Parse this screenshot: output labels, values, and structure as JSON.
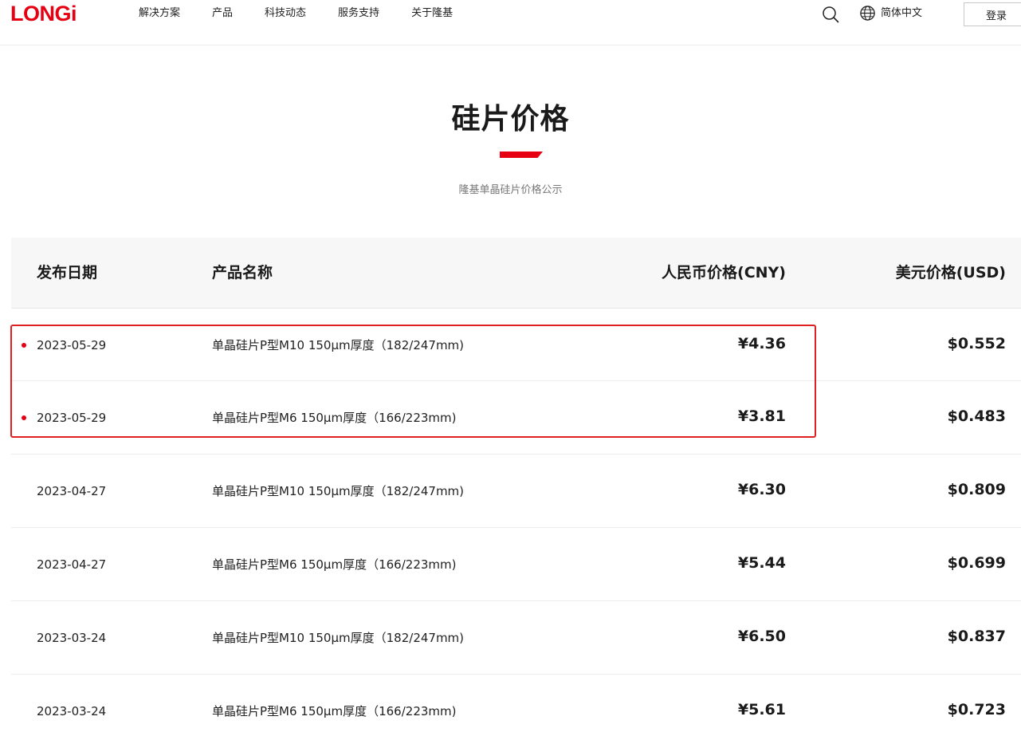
{
  "header": {
    "logo": "LONGi",
    "nav": [
      "解决方案",
      "产品",
      "科技动态",
      "服务支持",
      "关于隆基"
    ],
    "language": "简体中文",
    "login": "登录",
    "icons": {
      "search": "search-icon",
      "language": "globe-icon"
    }
  },
  "page": {
    "title": "硅片价格",
    "subtitle": "隆基单晶硅片价格公示"
  },
  "table": {
    "headers": [
      "发布日期",
      "产品名称",
      "人民币价格(CNY)",
      "美元价格(USD)"
    ],
    "rows": [
      {
        "date": "2023-05-29",
        "name": "单晶硅片P型M10 150μm厚度（182/247mm)",
        "cny": "¥4.36",
        "usd": "$0.552",
        "latest": true
      },
      {
        "date": "2023-05-29",
        "name": "单晶硅片P型M6 150μm厚度（166/223mm)",
        "cny": "¥3.81",
        "usd": "$0.483",
        "latest": true
      },
      {
        "date": "2023-04-27",
        "name": "单晶硅片P型M10 150μm厚度（182/247mm)",
        "cny": "¥6.30",
        "usd": "$0.809",
        "latest": false
      },
      {
        "date": "2023-04-27",
        "name": "单晶硅片P型M6 150μm厚度（166/223mm)",
        "cny": "¥5.44",
        "usd": "$0.699",
        "latest": false
      },
      {
        "date": "2023-03-24",
        "name": "单晶硅片P型M10 150μm厚度（182/247mm)",
        "cny": "¥6.50",
        "usd": "$0.837",
        "latest": false
      },
      {
        "date": "2023-03-24",
        "name": "单晶硅片P型M6 150μm厚度（166/223mm)",
        "cny": "¥5.61",
        "usd": "$0.723",
        "latest": false
      }
    ]
  },
  "colors": {
    "brand": "#e60012",
    "highlight": "#e02020"
  }
}
